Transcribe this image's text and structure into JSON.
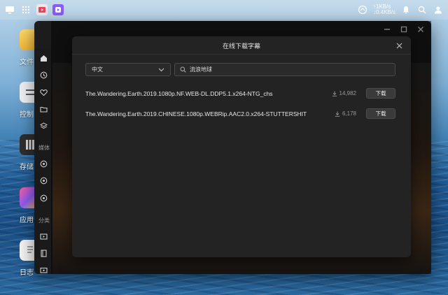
{
  "desktop": {
    "items": [
      {
        "label": "文件"
      },
      {
        "label": "控制"
      },
      {
        "label": "存储"
      },
      {
        "label": "应用"
      },
      {
        "label": "日志"
      }
    ]
  },
  "topbar": {
    "upload_speed": "↑1KB/s",
    "download_speed": "↓0.4KB/s"
  },
  "sidebar": {
    "section_media": "媒体",
    "section_category": "分类"
  },
  "modal": {
    "title": "在线下载字幕",
    "language": "中文",
    "search_value": "流浪地球",
    "results": [
      {
        "name": "The.Wandering.Earth.2019.1080p.NF.WEB-DL.DDP5.1.x264-NTG_chs",
        "count": "14,982",
        "button": "下载"
      },
      {
        "name": "The.Wandering.Earth.2019.CHINESE.1080p.WEBRip.AAC2.0.x264-STUTTERSHIT",
        "count": "6,178",
        "button": "下载"
      }
    ]
  },
  "colors": {
    "modal_bg": "#232323",
    "button_bg": "#3a3a3a",
    "text_primary": "#e8e8e8",
    "text_secondary": "#9a9a9a"
  }
}
